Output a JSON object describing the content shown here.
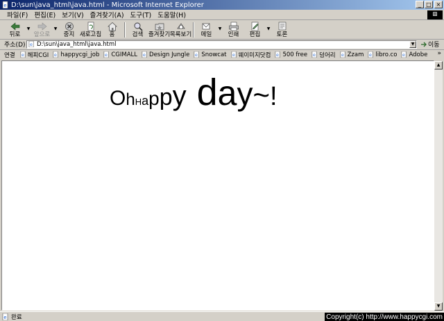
{
  "window": {
    "title": "D:\\sun\\java_html\\java.html - Microsoft Internet Explorer",
    "minimize": "_",
    "maximize": "□",
    "close": "×"
  },
  "menu": {
    "items": [
      "파일(F)",
      "편집(E)",
      "보기(V)",
      "즐겨찾기(A)",
      "도구(T)",
      "도움말(H)"
    ]
  },
  "toolbar": {
    "back": "뒤로",
    "forward": "앞으로",
    "stop": "중지",
    "refresh": "새로고침",
    "home": "홈",
    "search": "검색",
    "favorites": "즐겨찾기",
    "history": "목록보기",
    "mail": "메일",
    "print": "인쇄",
    "edit": "편집",
    "discuss": "토론"
  },
  "address": {
    "label": "주소(D)",
    "value": "D:\\sun\\java_html\\java.html",
    "go": "이동"
  },
  "links": {
    "label": "연결",
    "items": [
      "헤피CGI",
      "happycgi_job",
      "CGIMALL",
      "Design Jungle",
      "Snowcat",
      "웨이미지닷컴",
      "500 free",
      "덩어리",
      "Zzam",
      "libro.co",
      "Adobe"
    ]
  },
  "content": {
    "headline_parts": [
      "O",
      "h",
      "H",
      "a",
      "p",
      "p",
      "y",
      " d",
      "a",
      "y",
      "~",
      "!"
    ]
  },
  "status": {
    "text": "완료",
    "copyright": "Copyright(c) http://www.happycgi.com"
  },
  "colors": {
    "titlebar_start": "#0a246a",
    "titlebar_end": "#a6caf0",
    "chrome": "#d4d0c8"
  }
}
